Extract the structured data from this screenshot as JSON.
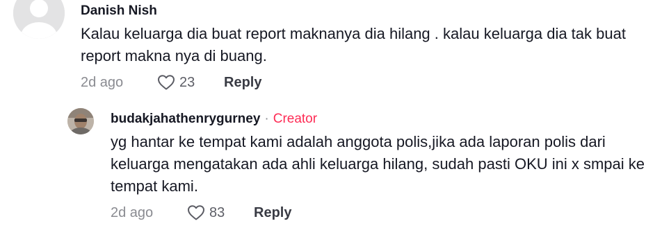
{
  "comment": {
    "username": "Danish Nish",
    "text": "Kalau keluarga dia buat report maknanya dia hilang . kalau keluarga dia tak buat report makna nya di buang.",
    "date": "2d ago",
    "likes": "23",
    "reply_label": "Reply"
  },
  "reply": {
    "username": "budakjahathenrygurney",
    "separator": "·",
    "creator_badge": "Creator",
    "text": "yg hantar ke tempat kami adalah anggota polis,jika ada laporan polis dari keluarga mengatakan ada ahli keluarga hilang, sudah pasti OKU ini x smpai ke tempat kami.",
    "date": "2d ago",
    "likes": "83",
    "reply_label": "Reply"
  },
  "icons": {
    "like": "heart-outline-icon",
    "default_avatar": "default-avatar-icon"
  },
  "colors": {
    "creator_accent": "#fe2c55",
    "meta_gray": "#8a8b91",
    "text": "#161823"
  }
}
